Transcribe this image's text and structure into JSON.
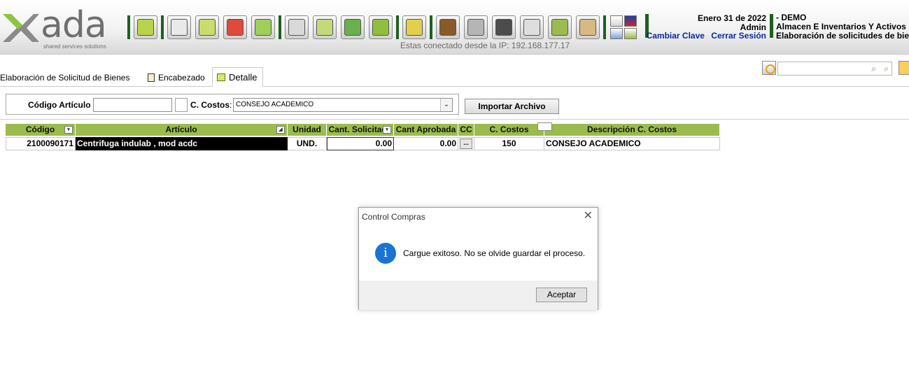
{
  "brand": {
    "logo_word": "ada",
    "tagline": "shared services solutions",
    "accent": "#9bbb4e",
    "dark_green": "#1f5f1f"
  },
  "toolbar": {
    "icons": [
      "new-icon",
      "add-icon",
      "save-icon",
      "delete-icon",
      "undo-icon",
      "print-icon",
      "search-icon",
      "excel-icon",
      "basket-icon",
      "lock-icon",
      "money-icon",
      "camera-icon",
      "grid-icon",
      "cart-icon",
      "approve-icon",
      "users-icon"
    ],
    "ip_text": "Estas conectado desde la IP: 192.168.177.17"
  },
  "user": {
    "date": "Enero 31 de 2022",
    "name": "Admin",
    "change_password": "Cambiar Clave",
    "logout": "Cerrar Sesión",
    "company": "- DEMO",
    "module": "Almacen E Inventarios Y Activos",
    "process": "Elaboración de solicitudes de bienes"
  },
  "tabs": [
    {
      "label": "Elaboración de Solicitud de Bienes",
      "active": false
    },
    {
      "label": "Encabezado",
      "active": false
    },
    {
      "label": "Detalle",
      "active": true
    }
  ],
  "filter": {
    "codigo_label": "Código Artículo",
    "codigo_value": "",
    "cc_label": "C. Costos",
    "cc_colon": ":",
    "cc_selected": "CONSEJO ACADEMICO",
    "import_label": "Importar Archivo"
  },
  "grid": {
    "columns": [
      "Código",
      "Artículo",
      "Unidad",
      "Cant. Solicitada",
      "Cant Aprobada",
      "CC",
      "C. Costos",
      "Descripción C. Costos"
    ],
    "rows": [
      {
        "codigo": "2100090171",
        "articulo": "Centrifuga indulab , mod acdc",
        "unidad": "UND.",
        "cant_solicitada": "0.00",
        "cant_aprobada": "0.00",
        "cc": "...",
        "c_costos": "150",
        "descripcion": "CONSEJO ACADEMICO"
      }
    ]
  },
  "dialog": {
    "title": "Control Compras",
    "message": "Cargue exitoso. No se olvide guardar el proceso.",
    "ok_label": "Aceptar",
    "close": "✕",
    "info_glyph": "i"
  }
}
